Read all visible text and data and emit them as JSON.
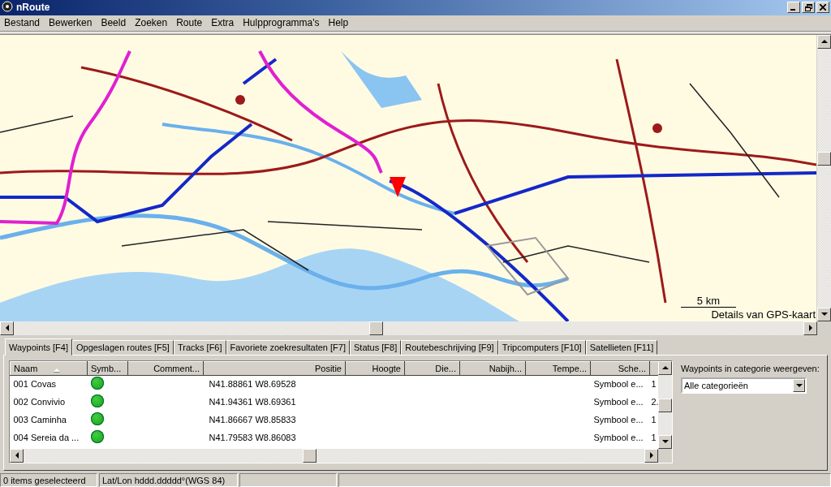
{
  "window": {
    "title": "nRoute"
  },
  "menu": [
    "Bestand",
    "Bewerken",
    "Beeld",
    "Zoeken",
    "Route",
    "Extra",
    "Hulpprogramma's",
    "Help"
  ],
  "map": {
    "kind": "picture",
    "scale": "5 km",
    "detail_note": "Details van GPS-kaart"
  },
  "tabs": [
    {
      "label": "Waypoints [F4]",
      "selected": true
    },
    {
      "label": "Opgeslagen routes [F5]",
      "selected": false
    },
    {
      "label": "Tracks [F6]",
      "selected": false
    },
    {
      "label": "Favoriete zoekresultaten [F7]",
      "selected": false
    },
    {
      "label": "Status [F8]",
      "selected": false
    },
    {
      "label": "Routebeschrijving [F9]",
      "selected": false
    },
    {
      "label": "Tripcomputers [F10]",
      "selected": false
    },
    {
      "label": "Satellieten [F11]",
      "selected": false
    }
  ],
  "table": {
    "columns": [
      {
        "label": "Naam",
        "sorted": true
      },
      {
        "label": "Symb...",
        "sorted": false
      },
      {
        "label": "Comment...",
        "sorted": false
      },
      {
        "label": "Positie",
        "sorted": false
      },
      {
        "label": "Hoogte",
        "sorted": false
      },
      {
        "label": "Die...",
        "sorted": false
      },
      {
        "label": "Nabijh...",
        "sorted": false
      },
      {
        "label": "Tempe...",
        "sorted": false
      },
      {
        "label": "Sche...",
        "sorted": false
      }
    ],
    "rows": [
      {
        "naam": "001 Covas",
        "positie": "N41.88861 W8.69528",
        "schema": "Symbool e...",
        "column_10": "1"
      },
      {
        "naam": "002 Convivio",
        "positie": "N41.94361 W8.69361",
        "schema": "Symbool e...",
        "column_10": "2."
      },
      {
        "naam": "003 Caminha",
        "positie": "N41.86667 W8.85833",
        "schema": "Symbool e...",
        "column_10": "1"
      },
      {
        "naam": "004 Sereia da ...",
        "positie": "N41.79583 W8.86083",
        "schema": "Symbool e...",
        "column_10": "1"
      }
    ]
  },
  "category_filter": {
    "label": "Waypoints in categorie weergeven:",
    "value": "Alle categorieën"
  },
  "status_bar": [
    "0 items geselecteerd",
    "Lat/Lon hddd.ddddd°(WGS 84)"
  ]
}
